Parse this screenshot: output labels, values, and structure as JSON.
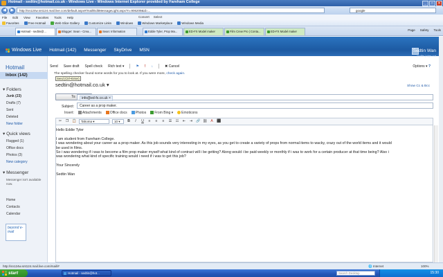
{
  "browser": {
    "title": "Hotmail - sedtin@hotmail.co.uk - Windows Live - Windows Internet Explorer provided by Fareham College",
    "url": "http://sn124w.snt124.mail.live.com/default.aspx#/mail/EditMessageLight.aspx?n=906209&id=...",
    "search_value": "google",
    "menu": [
      "File",
      "Edit",
      "View",
      "Favorites",
      "Tools",
      "Help"
    ],
    "convert": [
      "Convert",
      "Select"
    ],
    "favorites": [
      "Favorites",
      "Free Hotmail",
      "Web Slice Gallery",
      "Customize Links",
      "Windows",
      "Windows Marketplace",
      "Windows Media"
    ],
    "tabs": [
      "Hotmail - sedtin@...",
      "Blogger: Sean - Crea...",
      "Sean: Information",
      "Eddie Tyler, Prop Ma...",
      "ED-FX Model maker",
      "Film Crew Pro | Conta...",
      "ED-FX Model maker"
    ],
    "page_tools": [
      "Page",
      "Safety",
      "Tools"
    ],
    "status_url": "http://sn124w.snt124.mail.live.com/mail/#",
    "status_zone": "Internet",
    "status_zoom": "100%"
  },
  "wl_header": {
    "brand": "Windows Live",
    "nav": [
      "Hotmail (142)",
      "Messenger",
      "SkyDrive",
      "MSN"
    ],
    "user_name": "Sedtin Wan",
    "user_links": "profile | sign out"
  },
  "sidebar": {
    "title": "Hotmail",
    "inbox": "Inbox (142)",
    "folders_header": "Folders",
    "folders": [
      "Junk (23)",
      "Drafts (7)",
      "Sent",
      "Deleted"
    ],
    "new_folder": "New folder",
    "quick_views_header": "Quick views",
    "quick_views": [
      "Flagged (1)",
      "Office docs",
      "Photos (3)"
    ],
    "new_category": "New category",
    "messenger_header": "Messenger",
    "messenger_text": "Messenger isn't available now.",
    "bottom": [
      "Home",
      "Contacts",
      "Calendar"
    ],
    "ad_text": "beyond e-mail"
  },
  "compose": {
    "toolbar": [
      "Send",
      "Save draft",
      "Spell check",
      "Rich text"
    ],
    "cancel": "Cancel",
    "options": "Options",
    "spell_note": "The spelling checker found some words for you to look at. If you were more,",
    "spell_link": "check again.",
    "tooltip": "Send (Ctrl+Enter)",
    "from": "sedtin@hotmail.co.uk",
    "show_cc": "Show Cc & Bcc",
    "to_label": "To:",
    "to_value": "info@ed-fx.co.uk",
    "subject_label": "Subject:",
    "subject_value": "Career as a prop maker.",
    "insert_label": "Insert:",
    "insert_items": [
      "Attachments",
      "Office docs",
      "Photos",
      "From Bing",
      "Emoticons"
    ],
    "font_name": "Tahoma",
    "font_size": "10"
  },
  "message": {
    "lines": [
      "Hello Eddie Tyler",
      "",
      "I am student from Fareham College.",
      "I was wondering about your career as a prop maker. As this job sounds very interesting in my eyes, as you get to create a variety of props from normal items to wacky, crazy out of the world items and it would",
      "be used in films.",
      "So i was wondering if i was to become a film prop maker myself what kind of contract will i be getting? Along would i be paid weekly or monthly if i was to work for a certain producer at that time being? Also i",
      "was wondering what kind of specific training would i need if i was to get this job?",
      "",
      "Your Sincerely",
      "",
      "Sedtin Wan"
    ]
  },
  "taskbar": {
    "start": "start",
    "task": "Hotmail - sedtin@hot...",
    "search_placeholder": "Search Desktop",
    "clock": "15:30"
  },
  "colors": {
    "wl_blue": "#1d5aa2",
    "link_blue": "#1f5aa8",
    "inbox_selected": "#c6d9f2",
    "start_green": "#2d8a25"
  }
}
